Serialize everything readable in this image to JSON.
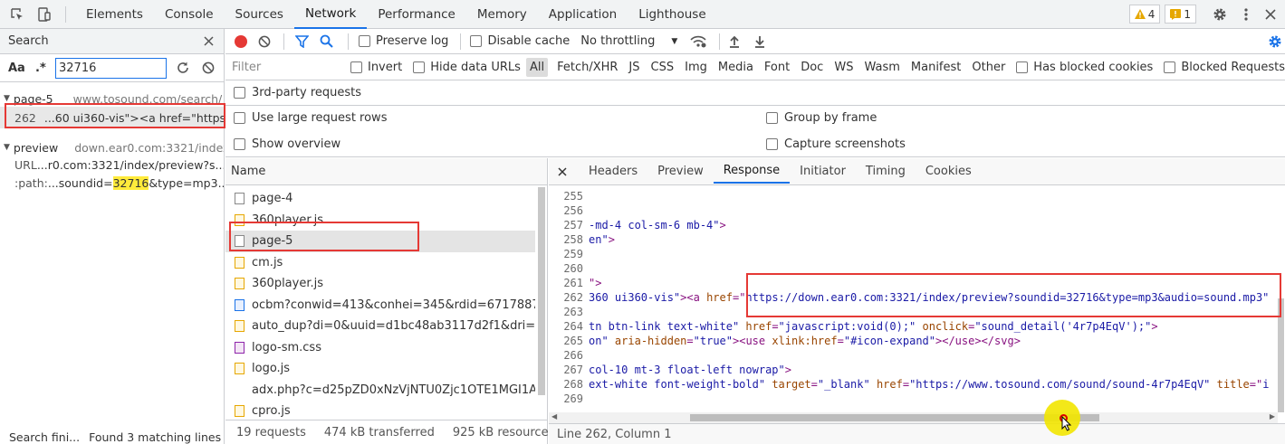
{
  "toolbar": {
    "tabs": [
      "Elements",
      "Console",
      "Sources",
      "Network",
      "Performance",
      "Memory",
      "Application",
      "Lighthouse"
    ],
    "active_tab": "Network",
    "warnings": "4",
    "errors": "1"
  },
  "search": {
    "title": "Search",
    "aa_label": "Aa",
    "regex_label": ".*",
    "query": "32716",
    "result1_file": "page-5",
    "result1_url": "www.tosound.com/search/",
    "result1_line": "262",
    "result1_text": "...60 ui360-vis\"><a href=\"https:...",
    "result2_file": "preview",
    "result2_url": "down.ear0.com:3321/index...",
    "result2_k1": "URL",
    "result2_v1": "...r0.com:3321/index/preview?s...",
    "result2_k2": ":path:",
    "result2_v2_pre": "...soundid=",
    "result2_v2_hl": "32716",
    "result2_v2_post": "&type=mp3...",
    "status_left": "Search fini...",
    "status_right": "Found 3 matching lines ..."
  },
  "network": {
    "preserve_log": "Preserve log",
    "disable_cache": "Disable cache",
    "throttling": "No throttling",
    "filter_placeholder": "Filter",
    "invert": "Invert",
    "hide_data_urls": "Hide data URLs",
    "types": [
      "All",
      "Fetch/XHR",
      "JS",
      "CSS",
      "Img",
      "Media",
      "Font",
      "Doc",
      "WS",
      "Wasm",
      "Manifest",
      "Other"
    ],
    "has_blocked_cookies": "Has blocked cookies",
    "blocked_requests": "Blocked Requests",
    "third_party": "3rd-party requests",
    "large_rows": "Use large request rows",
    "group_by_frame": "Group by frame",
    "show_overview": "Show overview",
    "capture_screenshots": "Capture screenshots",
    "name_header": "Name",
    "requests": [
      {
        "name": "page-4",
        "kind": "doc"
      },
      {
        "name": "360player.js",
        "kind": "js"
      },
      {
        "name": "page-5",
        "kind": "doc"
      },
      {
        "name": "cm.js",
        "kind": "js"
      },
      {
        "name": "360player.js",
        "kind": "js"
      },
      {
        "name": "ocbm?conwid=413&conhei=345&rdid=6717887&dc...",
        "kind": "docblue"
      },
      {
        "name": "auto_dup?di=0&uuid=d1bc48ab3117d2f1&dri=0&d...",
        "kind": "js"
      },
      {
        "name": "logo-sm.css",
        "kind": "css"
      },
      {
        "name": "logo.js",
        "kind": "js"
      },
      {
        "name": "adx.php?c=d25pZD0xNzVjNTU0Zjc1OTE1MGI1AHM...",
        "kind": "none"
      },
      {
        "name": "cpro.js",
        "kind": "js"
      }
    ],
    "status_requests": "19 requests",
    "status_transferred": "474 kB transferred",
    "status_resources": "925 kB resources",
    "detail_tabs": [
      "Headers",
      "Preview",
      "Response",
      "Initiator",
      "Timing",
      "Cookies"
    ],
    "detail_active": "Response",
    "cursor_pos": "Line 262, Column 1"
  },
  "code": [
    {
      "n": "255",
      "parts": []
    },
    {
      "n": "256",
      "parts": []
    },
    {
      "n": "257",
      "parts": [
        [
          "val",
          "-md-4 col-sm-6 mb-4\""
        ],
        [
          "tag",
          ">"
        ]
      ]
    },
    {
      "n": "258",
      "parts": [
        [
          "val",
          "en\""
        ],
        [
          "tag",
          ">"
        ]
      ]
    },
    {
      "n": "259",
      "parts": []
    },
    {
      "n": "260",
      "parts": []
    },
    {
      "n": "261",
      "parts": [
        [
          "tag",
          "\">"
        ]
      ]
    },
    {
      "n": "262",
      "parts": [
        [
          "val",
          "360 ui360-vis\""
        ],
        [
          "tag",
          "><a "
        ],
        [
          "attr",
          "href"
        ],
        [
          "tag",
          "=\""
        ],
        [
          "val",
          "https://down.ear0.com:3321/index/preview?soundid=32716&type=mp3&audio=sound.mp3\""
        ]
      ]
    },
    {
      "n": "263",
      "parts": []
    },
    {
      "n": "264",
      "parts": [
        [
          "val",
          "tn btn-link text-white\""
        ],
        [
          "txt",
          " "
        ],
        [
          "attr",
          "href"
        ],
        [
          "tag",
          "="
        ],
        [
          "val",
          "\"javascript:void(0);\""
        ],
        [
          "txt",
          " "
        ],
        [
          "attr",
          "onclick"
        ],
        [
          "tag",
          "="
        ],
        [
          "val",
          "\"sound_detail('4r7p4EqV');\""
        ],
        [
          "tag",
          ">"
        ]
      ]
    },
    {
      "n": "265",
      "parts": [
        [
          "val",
          "on\""
        ],
        [
          "txt",
          " "
        ],
        [
          "attr",
          "aria-hidden"
        ],
        [
          "tag",
          "="
        ],
        [
          "val",
          "\"true\""
        ],
        [
          "tag",
          "><use "
        ],
        [
          "attr",
          "xlink:href"
        ],
        [
          "tag",
          "="
        ],
        [
          "val",
          "\"#icon-expand\""
        ],
        [
          "tag",
          "></use></svg>"
        ]
      ]
    },
    {
      "n": "266",
      "parts": []
    },
    {
      "n": "267",
      "parts": [
        [
          "val",
          "col-10 mt-3 float-left nowrap\""
        ],
        [
          "tag",
          ">"
        ]
      ]
    },
    {
      "n": "268",
      "parts": [
        [
          "val",
          "ext-white font-weight-bold\""
        ],
        [
          "txt",
          " "
        ],
        [
          "attr",
          "target"
        ],
        [
          "tag",
          "="
        ],
        [
          "val",
          "\"_blank\""
        ],
        [
          "txt",
          " "
        ],
        [
          "attr",
          "href"
        ],
        [
          "tag",
          "="
        ],
        [
          "val",
          "\"https://www.tosound.com/sound/sound-4r7p4EqV\""
        ],
        [
          "txt",
          " "
        ],
        [
          "attr",
          "title"
        ],
        [
          "tag",
          "=\""
        ],
        [
          "val",
          "i"
        ]
      ]
    },
    {
      "n": "269",
      "parts": []
    }
  ]
}
